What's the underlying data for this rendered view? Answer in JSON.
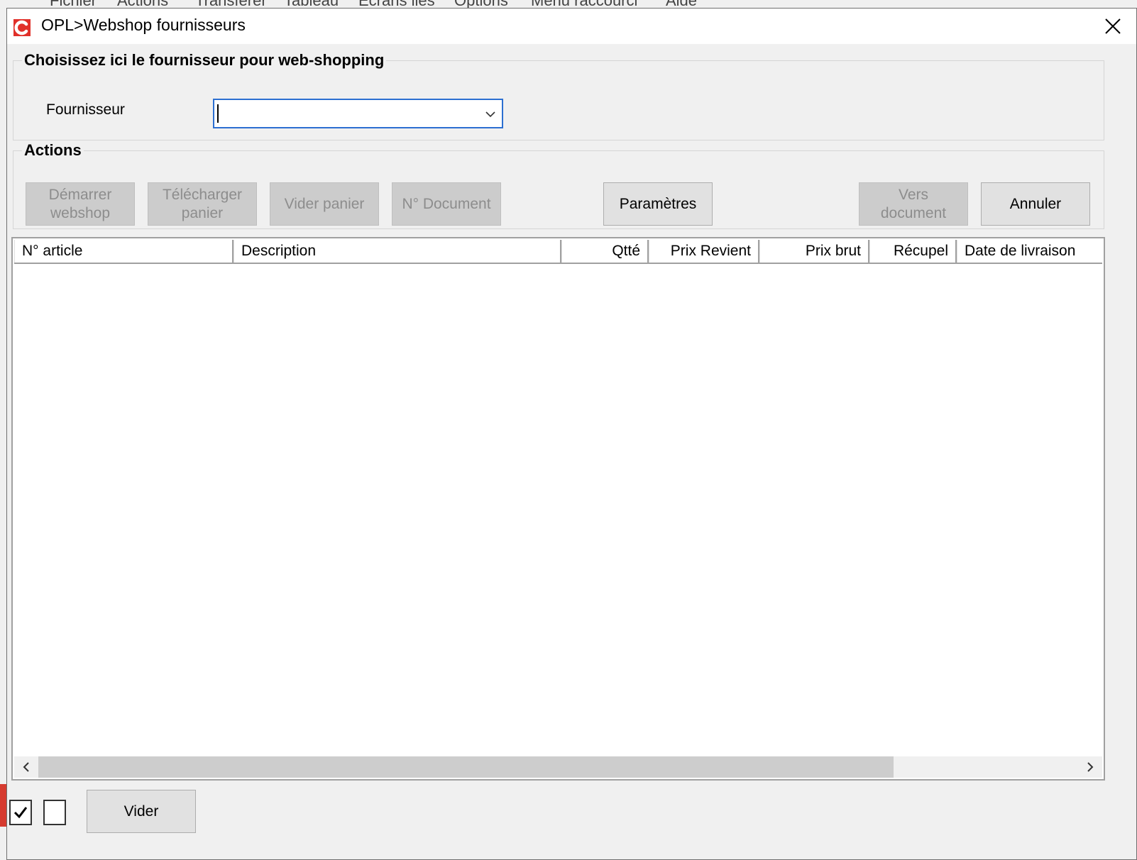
{
  "background_app": {
    "menu": [
      "Fichier",
      "Actions",
      "Transférer",
      "Tableau",
      "Écrans liés",
      "Options",
      "Menu raccourci",
      "Aide"
    ]
  },
  "dialog": {
    "title": "OPL>Webshop fournisseurs",
    "supplier_group": {
      "legend": "Choisissez ici le fournisseur pour web-shopping",
      "label": "Fournisseur",
      "value": ""
    },
    "actions_group": {
      "legend": "Actions",
      "buttons": {
        "start_webshop": "Démarrer\nwebshop",
        "download_cart": "Télécharger\npanier",
        "empty_cart": "Vider panier",
        "doc_number": "N° Document",
        "parameters": "Paramètres",
        "to_document": "Vers document",
        "cancel": "Annuler"
      }
    },
    "grid": {
      "columns": [
        "N° article",
        "Description",
        "Qtté",
        "Prix Revient",
        "Prix brut",
        "Récupel",
        "Date de livraison"
      ],
      "rows": []
    },
    "footer": {
      "checkbox1_checked": true,
      "checkbox2_checked": false,
      "clear_button": "Vider"
    }
  }
}
